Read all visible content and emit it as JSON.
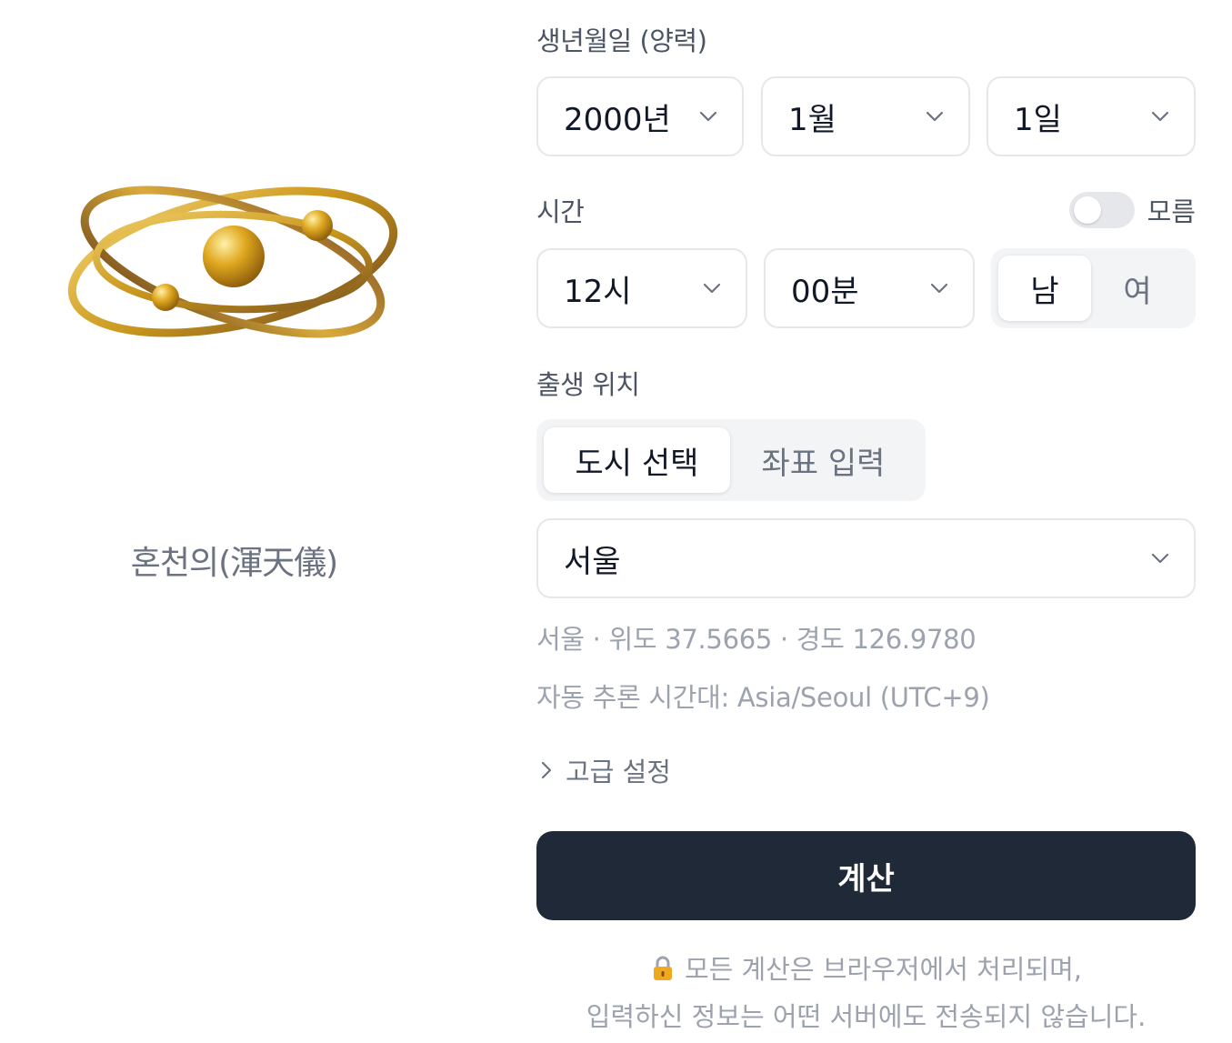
{
  "illustration": {
    "icon": "armillary-sphere-icon",
    "caption": "혼천의(渾天儀)"
  },
  "birthdate": {
    "label": "생년월일 (양력)",
    "year": "2000년",
    "month": "1월",
    "day": "1일"
  },
  "time": {
    "label": "시간",
    "unknown_label": "모름",
    "unknown_toggle_on": false,
    "hour": "12시",
    "minute": "00분"
  },
  "gender": {
    "options": [
      "남",
      "여"
    ],
    "selected": "남"
  },
  "location": {
    "label": "출생 위치",
    "tabs": [
      "도시 선택",
      "좌표 입력"
    ],
    "active_tab": "도시 선택",
    "city": "서울",
    "coords_text": "서울 · 위도 37.5665 · 경도 126.9780",
    "timezone_text": "자동 추론 시간대: Asia/Seoul (UTC+9)"
  },
  "advanced": {
    "label": "고급 설정"
  },
  "calculate": {
    "label": "계산"
  },
  "notice": {
    "icon": "lock-icon",
    "line1": "모든 계산은 브라우저에서 처리되며,",
    "line2": "입력하신 정보는 어떤 서버에도 전송되지 않습니다."
  },
  "colors": {
    "primary_button": "#1f2937",
    "gold": "#c9971c",
    "muted_text": "#9ca3af"
  }
}
